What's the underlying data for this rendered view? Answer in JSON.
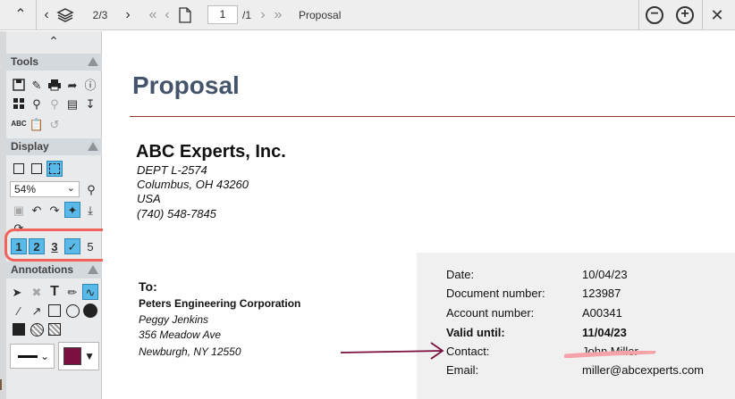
{
  "toolbar": {
    "page_of_layers": "2/3",
    "page_input": "1",
    "page_total": "/1",
    "doc_name": "Proposal"
  },
  "sidebar": {
    "tools_label": "Tools",
    "display_label": "Display",
    "zoom_value": "54%",
    "annotations_label": "Annotations",
    "stroke_color": "#7a1040",
    "highlight_ring_color": "#f2625a"
  },
  "document": {
    "title": "Proposal",
    "company": "ABC Experts, Inc.",
    "address": [
      "DEPT L-2574",
      "Columbus, OH 43260",
      "USA",
      "(740) 548-7845"
    ],
    "to_label": "To:",
    "to_company": "Peters Engineering Corporation",
    "to_lines": [
      "Peggy Jenkins",
      "356 Meadow Ave",
      "Newburgh, NY 12550"
    ],
    "info": [
      {
        "label": "Date:",
        "value": "10/04/23",
        "bold": false
      },
      {
        "label": "Document number:",
        "value": "123987",
        "bold": false
      },
      {
        "label": "Account number:",
        "value": "A00341",
        "bold": false
      },
      {
        "label": "Valid until:",
        "value": "11/04/23",
        "bold": true
      },
      {
        "label": "Contact:",
        "value": "John Miller",
        "bold": false
      },
      {
        "label": "Email:",
        "value": "miller@abcexperts.com",
        "bold": false
      }
    ]
  }
}
